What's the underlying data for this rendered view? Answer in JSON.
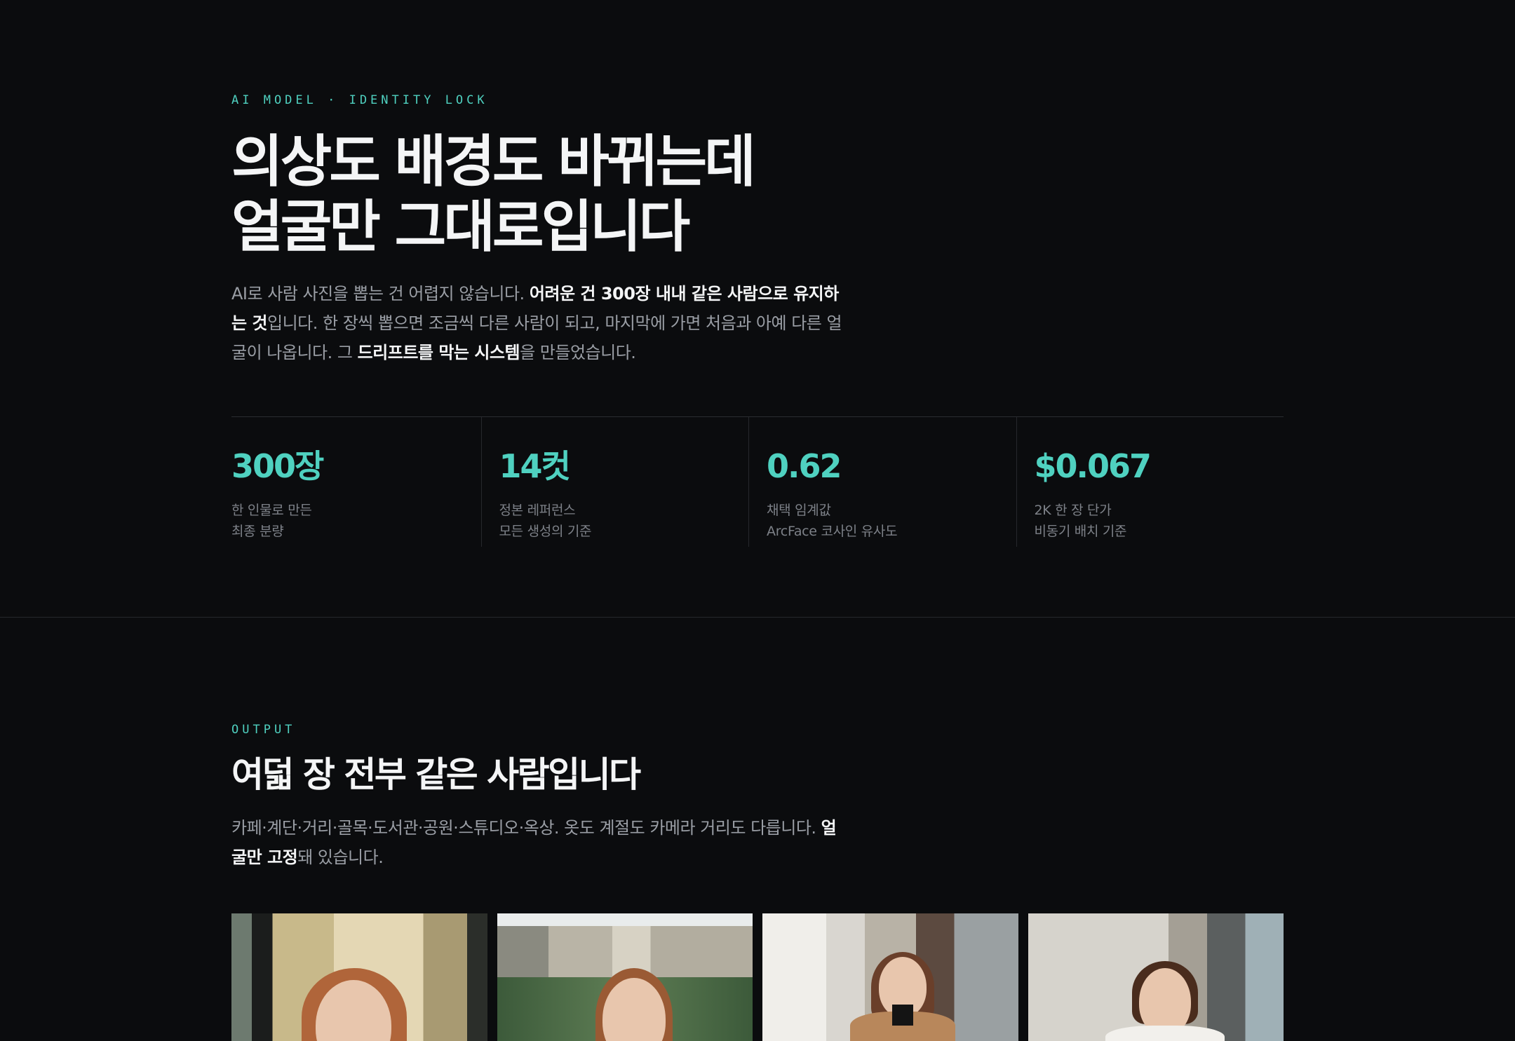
{
  "hero": {
    "eyebrow": "AI MODEL · IDENTITY LOCK",
    "headline_line1": "의상도 배경도 바뀌는데",
    "headline_line2": "얼굴만 그대로입니다",
    "lead": {
      "t1": "AI로 사람 사진을 뽑는 건 어렵지 않습니다. ",
      "b1": "어려운 건 300장 내내 같은 사람으로 유지하는 것",
      "t2": "입니다. 한 장씩 뽑으면 조금씩 다른 사람이 되고, 마지막에 가면 처음과 아예 다른 얼굴이 나옵니다. 그 ",
      "b2": "드리프트를 막는 시스템",
      "t3": "을 만들었습니다."
    }
  },
  "stats": [
    {
      "value": "300장",
      "label1": "한 인물로 만든",
      "label2": "최종 분량"
    },
    {
      "value": "14컷",
      "label1": "정본 레퍼런스",
      "label2": "모든 생성의 기준"
    },
    {
      "value": "0.62",
      "label1": "채택 임계값",
      "label2": "ArcFace 코사인 유사도"
    },
    {
      "value": "$0.067",
      "label1": "2K 한 장 단가",
      "label2": "비동기 배치 기준"
    }
  ],
  "output": {
    "eyebrow": "OUTPUT",
    "title": "여덟 장 전부 같은 사람입니다",
    "lead": {
      "t1": "카페·계단·거리·골목·도서관·공원·스튜디오·옥상. 옷도 계절도 카메라 거리도 다릅니다. ",
      "b1": "얼굴만 고정",
      "t2": "돼 있습니다."
    }
  },
  "colors": {
    "background": "#0b0c0e",
    "accent": "#4fd1c0",
    "text_strong": "#f4f5f6",
    "text_muted": "#9a9ea5"
  }
}
